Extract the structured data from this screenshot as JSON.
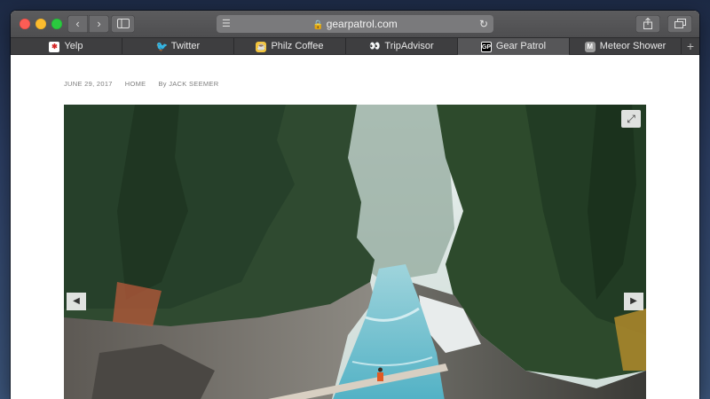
{
  "browser": {
    "address_url": "gearpatrol.com",
    "nav": {
      "back_icon": "chevron-left-icon",
      "forward_icon": "chevron-right-icon"
    }
  },
  "favorites": [
    {
      "label": "Yelp",
      "icon": "yelp-icon",
      "glyph": "✱"
    },
    {
      "label": "Twitter",
      "icon": "twitter-icon",
      "glyph": "🐦"
    },
    {
      "label": "Philz Coffee",
      "icon": "philz-coffee-icon",
      "glyph": "☕"
    },
    {
      "label": "TripAdvisor",
      "icon": "tripadvisor-icon",
      "glyph": "👀"
    },
    {
      "label": "Gear Patrol",
      "icon": "gear-patrol-icon",
      "glyph": "GP"
    },
    {
      "label": "Meteor Shower",
      "icon": "meteor-shower-icon",
      "glyph": "M"
    }
  ],
  "article": {
    "date": "JUNE 29, 2017",
    "section": "HOME",
    "byline": "By JACK SEEMER"
  },
  "colors": {
    "accent_close": "#fc5d55",
    "accent_min": "#fdbc2e",
    "accent_max": "#2ac93f",
    "river": "#5fb9c9"
  }
}
